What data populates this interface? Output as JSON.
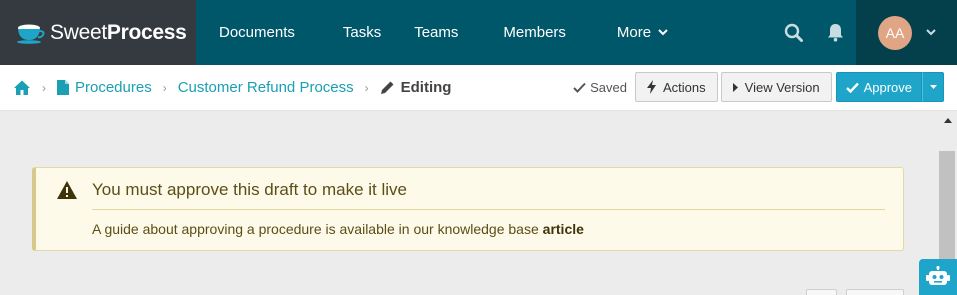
{
  "app": {
    "brand_sweet": "Sweet",
    "brand_process": "Process"
  },
  "nav": {
    "items": [
      {
        "label": "Documents"
      },
      {
        "label": "Tasks"
      },
      {
        "label": "Teams"
      },
      {
        "label": "Members"
      },
      {
        "label": "More"
      }
    ],
    "user_initials": "AA"
  },
  "breadcrumb": {
    "items": [
      {
        "label": "Procedures"
      },
      {
        "label": "Customer Refund Process"
      }
    ],
    "current": "Editing"
  },
  "toolbar": {
    "saved_label": "Saved",
    "actions_label": "Actions",
    "view_version_label": "View Version",
    "approve_label": "Approve"
  },
  "alert": {
    "title": "You must approve this draft to make it live",
    "body_text": "A guide about approving a procedure is available in our knowledge base",
    "link_text": "article"
  },
  "colors": {
    "nav_bg": "#01576a",
    "logo_bg": "#343a40",
    "user_bg": "#043f4c",
    "accent": "#1ea5c9",
    "link": "#1a9fb4",
    "alert_bg": "#fdfaea",
    "alert_text": "#5c4e16"
  },
  "icons": {
    "logo": "teacup-icon",
    "search": "search-icon",
    "notifications": "bell-icon",
    "home": "home-icon",
    "procedure": "document-icon",
    "editing": "pencil-icon",
    "saved": "check-icon",
    "actions": "bolt-icon",
    "view_version": "caret-right-icon",
    "approve": "check-icon",
    "alert": "warning-icon",
    "help_bot": "robot-icon"
  }
}
